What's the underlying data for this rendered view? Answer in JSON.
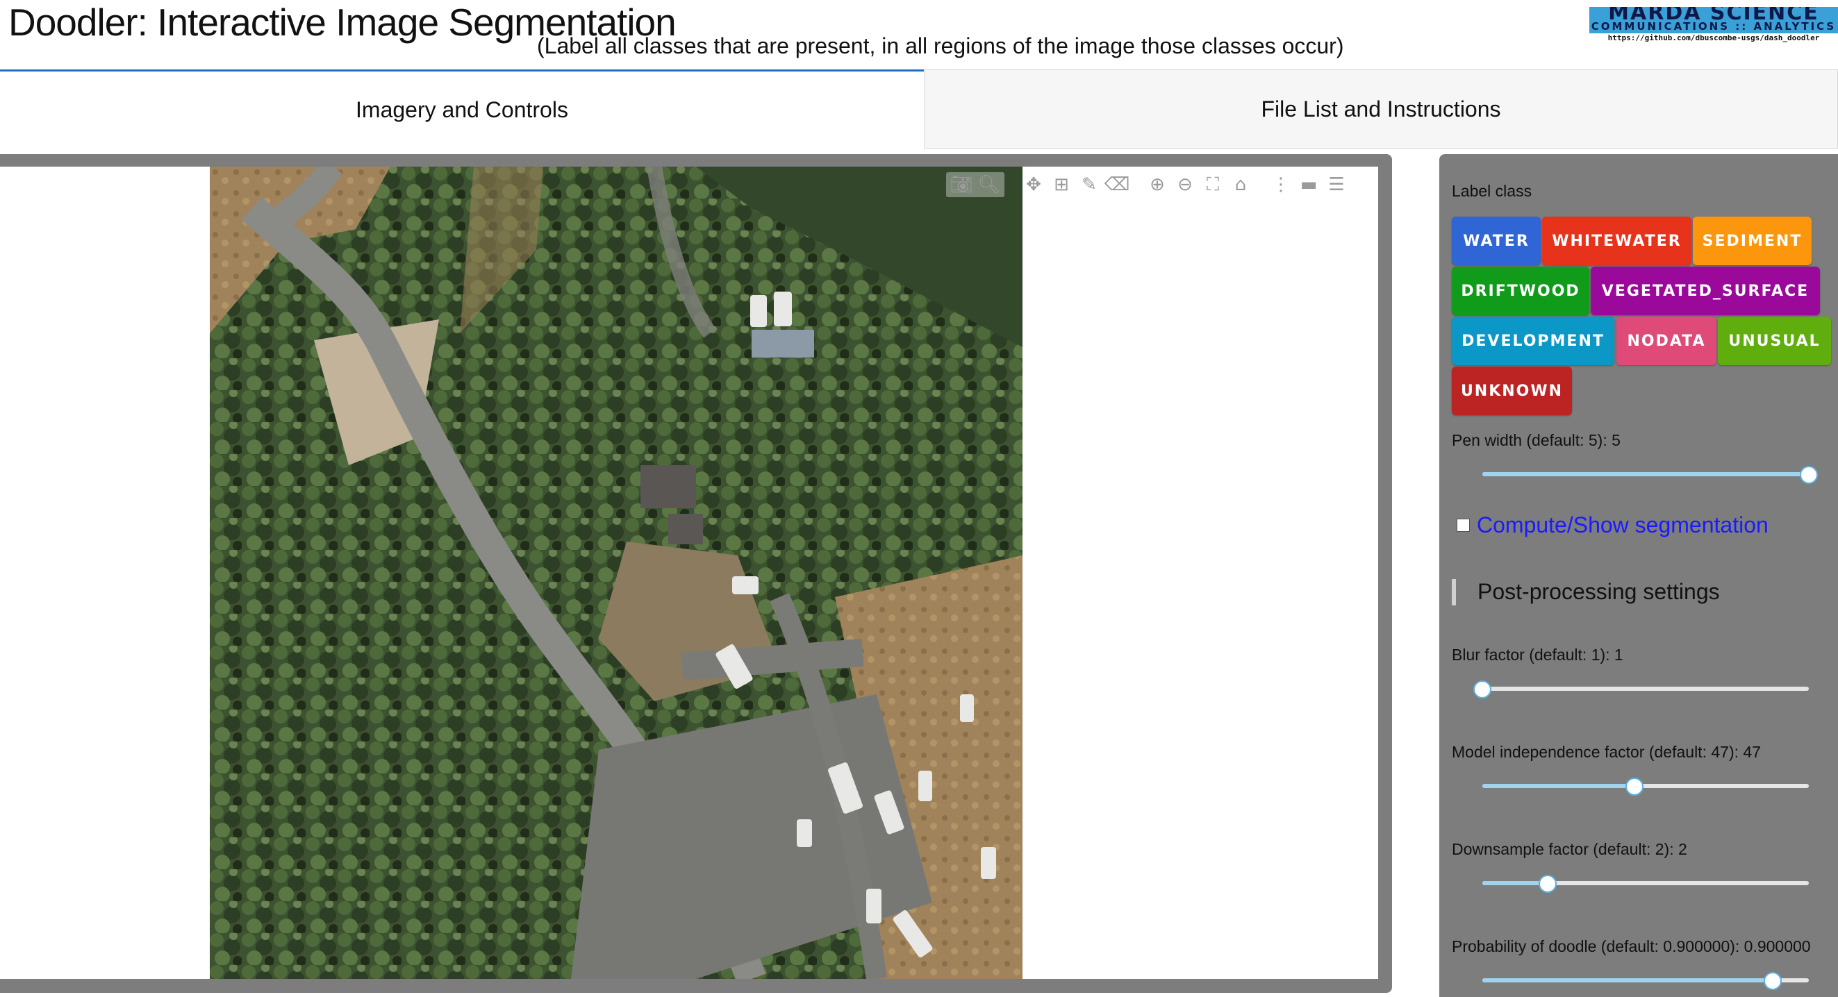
{
  "header": {
    "title": "Doodler: Interactive Image Segmentation",
    "subtitle": "(Label all classes that are present, in all regions of the image those classes occur)",
    "logo_line1": "MARDA SCIENCE",
    "logo_line2": "COMMUNICATIONS :: ANALYTICS",
    "logo_url": "https://github.com/dbuscombe-usgs/dash_doodler"
  },
  "tabs": [
    {
      "label": "Imagery and Controls",
      "active": true
    },
    {
      "label": "File List and Instructions",
      "active": false
    }
  ],
  "modebar": {
    "icons": [
      "camera-icon",
      "zoom-icon",
      "pan-icon",
      "box-select-icon",
      "draw-freehand-icon",
      "erase-shape-icon",
      "zoom-in-icon",
      "zoom-out-icon",
      "autoscale-icon",
      "reset-axes-icon",
      "spike-lines-icon",
      "hover-closest-icon",
      "hover-compare-icon"
    ]
  },
  "controls": {
    "label_class_title": "Label class",
    "classes": [
      {
        "label": "WATER",
        "color": "#2f65d4"
      },
      {
        "label": "WHITEWATER",
        "color": "#e8331c"
      },
      {
        "label": "SEDIMENT",
        "color": "#fc960c"
      },
      {
        "label": "DRIFTWOOD",
        "color": "#109b1a"
      },
      {
        "label": "VEGETATED_SURFACE",
        "color": "#9a099a"
      },
      {
        "label": "DEVELOPMENT",
        "color": "#0c98c7"
      },
      {
        "label": "NODATA",
        "color": "#e04a78"
      },
      {
        "label": "UNUSUAL",
        "color": "#5fae0e"
      },
      {
        "label": "UNKNOWN",
        "color": "#bc2424"
      }
    ],
    "pen_width_label": "Pen width (default: 5): 5",
    "pen_width_level": 1.0,
    "compute_label": "Compute/Show segmentation",
    "compute_checked": false,
    "postproc_title": "Post-processing settings",
    "blur_label": "Blur factor (default: 1): 1",
    "blur_level": 0.0,
    "model_independence_label": "Model independence factor (default: 47): 47",
    "model_independence_level": 0.465,
    "downsample_label": "Downsample factor (default: 2): 2",
    "downsample_level": 0.2,
    "probability_label": "Probability of doodle (default: 0.900000): 0.900000",
    "probability_level": 0.89
  }
}
